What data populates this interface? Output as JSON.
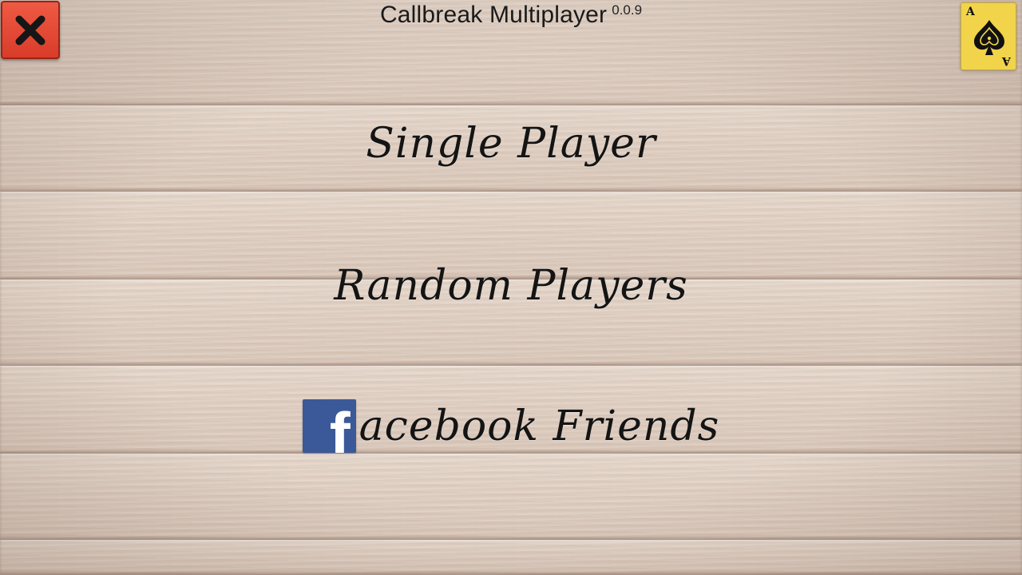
{
  "header": {
    "title": "Callbreak Multiplayer",
    "version": "0.0.9"
  },
  "close_button": {
    "icon": "close-icon"
  },
  "card_button": {
    "rank": "A",
    "suit": "spade-icon"
  },
  "menu": {
    "single_player": "Single Player",
    "random_players": "Random Players",
    "facebook": {
      "logo_letter": "f",
      "label": "acebook Friends"
    }
  },
  "colors": {
    "close_red": "#e34b36",
    "card_yellow": "#f2d44a",
    "facebook_blue": "#3b5998",
    "text": "#141414"
  }
}
